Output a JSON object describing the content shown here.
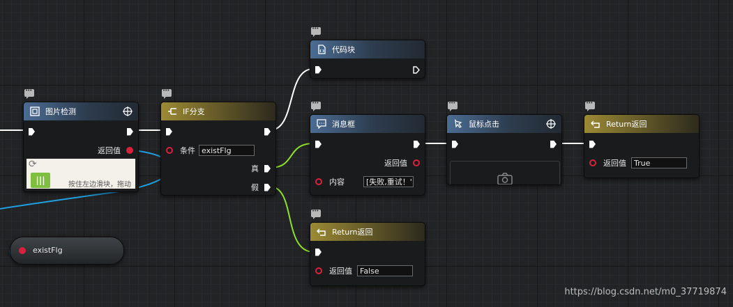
{
  "canvas": {
    "watermark": "https://blog.csdn.net/m0_37719874"
  },
  "nodes": {
    "image_detect": {
      "title": "图片检测",
      "return_label": "返回值",
      "thumb_text": "按住左边滑块，拖动"
    },
    "if_branch": {
      "title": "IF分支",
      "condition_label": "条件",
      "condition_value": "existFlg",
      "true_label": "真",
      "false_label": "假"
    },
    "code_block": {
      "title": "代码块"
    },
    "message_box": {
      "title": "消息框",
      "return_label": "返回值",
      "content_label": "内容",
      "content_value": "[失败,重试！'"
    },
    "mouse_click": {
      "title": "鼠标点击"
    },
    "return_true": {
      "title": "Return返回",
      "return_label": "返回值",
      "return_value": "True"
    },
    "return_false": {
      "title": "Return返回",
      "return_label": "返回值",
      "return_value": "False"
    },
    "variable": {
      "name": "existFlg"
    }
  },
  "colors": {
    "exec_wire": "#ffffff",
    "bool_wire": "#8fe02a",
    "data_wire": "#1fa0e0",
    "data_pin": "#d8223d",
    "header_blue": "#4b6c93",
    "header_gold": "#9c8a35"
  }
}
